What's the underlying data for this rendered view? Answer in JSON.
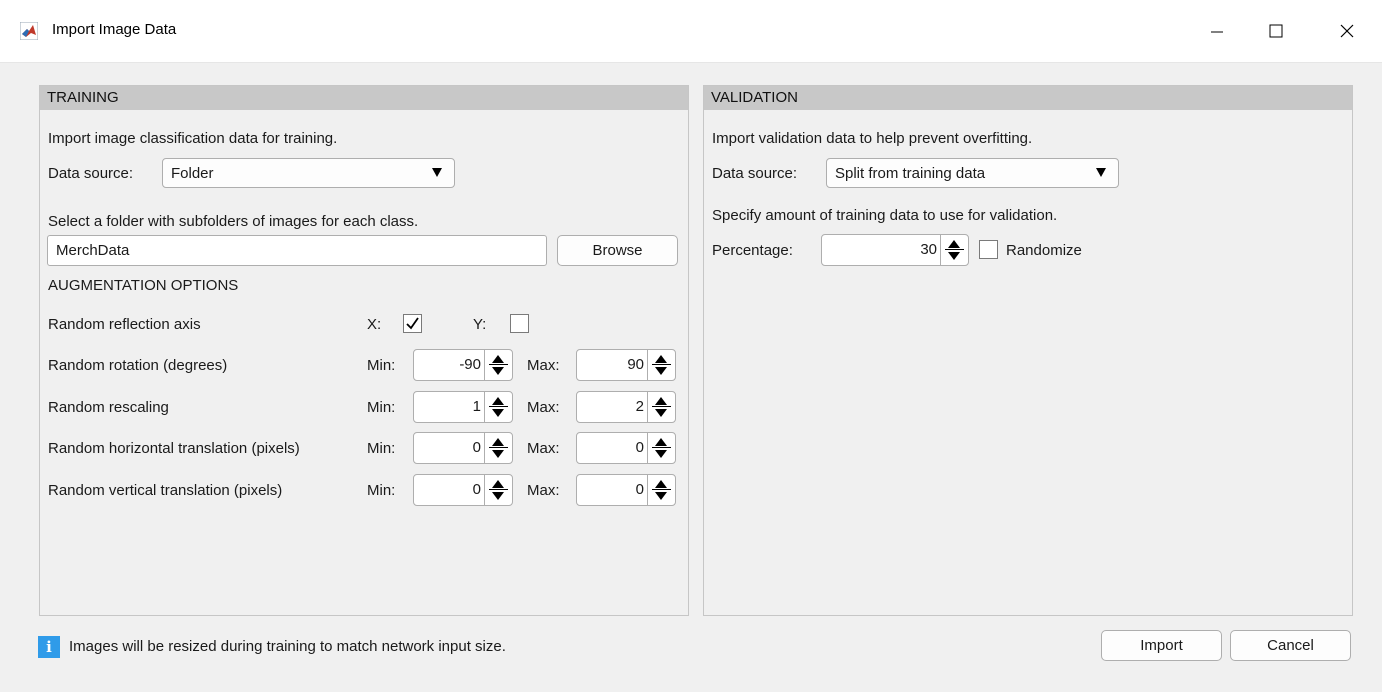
{
  "window": {
    "title": "Import Image Data",
    "icons": {
      "app": "matlab-logo-icon",
      "minimize": "minimize-icon",
      "maximize": "maximize-icon",
      "close": "close-icon"
    }
  },
  "training": {
    "header": "TRAINING",
    "description": "Import image classification data for training.",
    "data_source_label": "Data source:",
    "data_source_value": "Folder",
    "folder_instruction": "Select a folder with subfolders of images for each class.",
    "folder_value": "MerchData",
    "browse_label": "Browse",
    "augmentation": {
      "heading": "AUGMENTATION OPTIONS",
      "reflection": {
        "label": "Random reflection axis",
        "x_label": "X:",
        "x_checked": true,
        "y_label": "Y:",
        "y_checked": false
      },
      "rows": [
        {
          "label": "Random rotation (degrees)",
          "min_label": "Min:",
          "min": "-90",
          "max_label": "Max:",
          "max": "90"
        },
        {
          "label": "Random rescaling",
          "min_label": "Min:",
          "min": "1",
          "max_label": "Max:",
          "max": "2"
        },
        {
          "label": "Random horizontal translation (pixels)",
          "min_label": "Min:",
          "min": "0",
          "max_label": "Max:",
          "max": "0"
        },
        {
          "label": "Random vertical translation (pixels)",
          "min_label": "Min:",
          "min": "0",
          "max_label": "Max:",
          "max": "0"
        }
      ]
    }
  },
  "validation": {
    "header": "VALIDATION",
    "description": "Import validation data to help prevent overfitting.",
    "data_source_label": "Data source:",
    "data_source_value": "Split from training data",
    "amount_instruction": "Specify amount of training data to use for validation.",
    "percentage_label": "Percentage:",
    "percentage_value": "30",
    "randomize_label": "Randomize",
    "randomize_checked": false
  },
  "footer": {
    "info_icon": "info-icon",
    "info_glyph": "i",
    "info_text": "Images will be resized during training to match network input size.",
    "import_label": "Import",
    "cancel_label": "Cancel"
  },
  "colors": {
    "panel_header": "#c8c8c8",
    "info_icon": "#2f9be9",
    "background": "#f0f0f0"
  }
}
